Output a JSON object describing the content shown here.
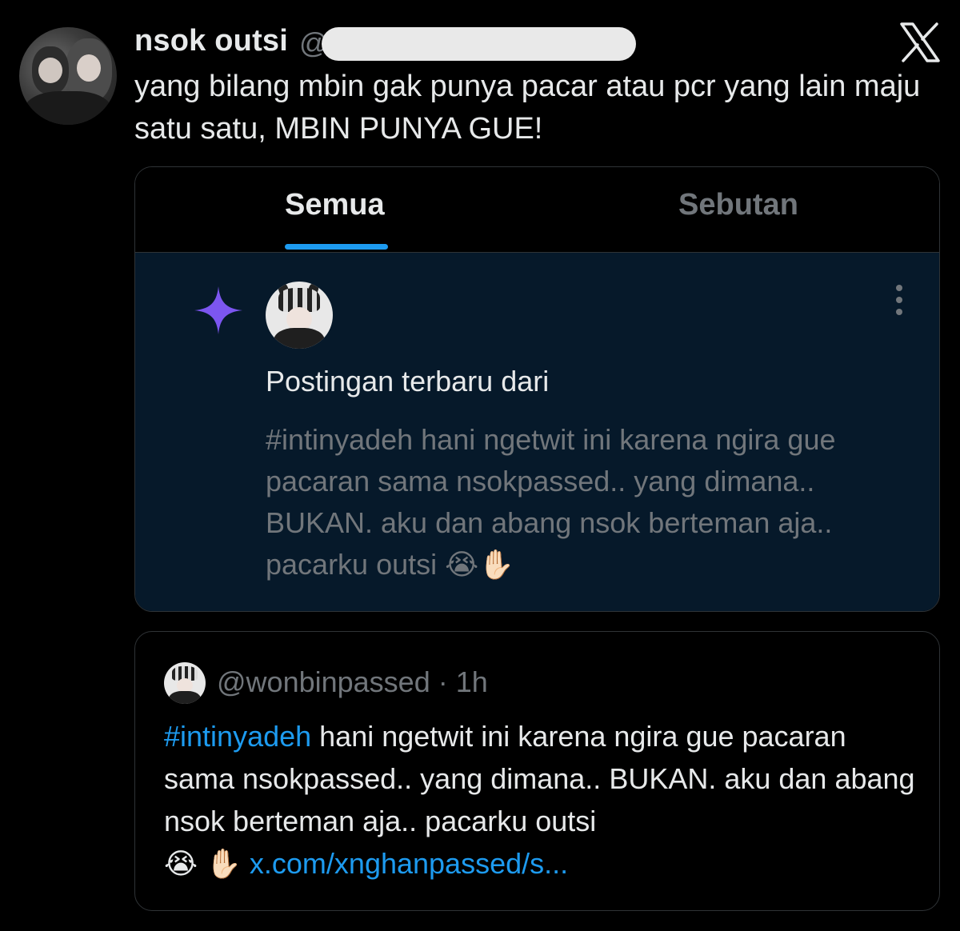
{
  "tweet": {
    "author_name": "nsok outsi",
    "handle_prefix": "@",
    "text": "yang bilang mbin gak punya pacar atau pcr yang lain maju satu satu, MBIN PUNYA GUE!"
  },
  "icons": {
    "platform_logo": "x-logo-icon",
    "sparkle": "sparkle-icon",
    "more": "more-options-icon"
  },
  "notification_card": {
    "tabs": [
      {
        "label": "Semua",
        "active": true
      },
      {
        "label": "Sebutan",
        "active": false
      }
    ],
    "title": "Postingan terbaru dari",
    "preview": "#intinyadeh hani ngetwit ini karena ngira gue pacaran sama nsokpassed.. yang dimana.. BUKAN. aku dan abang nsok berteman aja.. pacarku outsi 😭✋🏻"
  },
  "quoted_tweet": {
    "handle": "@wonbinpassed · 1h",
    "hashtag": "#intinyadeh",
    "text": " hani ngetwit ini karena ngira gue pacaran sama nsokpassed.. yang dimana.. BUKAN. aku dan abang nsok berteman aja.. pacarku outsi",
    "emoji": "😭 ✋🏻 ",
    "link": "x.com/xnghanpassed/s..."
  },
  "colors": {
    "background": "#000000",
    "accent_blue": "#1d9bf0",
    "sparkle_purple": "#7c56f0",
    "notification_bg": "#06192a",
    "muted_text": "#71767b"
  }
}
